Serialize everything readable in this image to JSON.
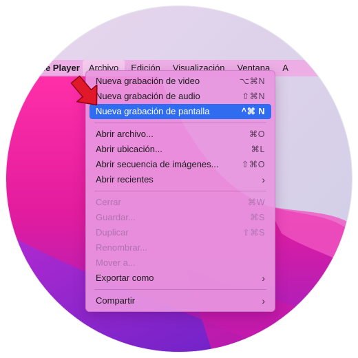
{
  "menubar": {
    "app_name": "ne Player",
    "items": [
      "Archivo",
      "Edición",
      "Visualización",
      "Ventana",
      "A"
    ]
  },
  "menu": {
    "items": [
      {
        "label": "Nueva grabación de video",
        "shortcut": "⌥⌘N",
        "state": "normal"
      },
      {
        "label": "Nueva grabación de audio",
        "shortcut": "⇧⌘N",
        "state": "normal"
      },
      {
        "label": "Nueva grabación de pantalla",
        "shortcut": "^⌘ N",
        "state": "highlighted"
      },
      {
        "label": "Abrir archivo...",
        "shortcut": "⌘O",
        "state": "normal"
      },
      {
        "label": "Abrir ubicación...",
        "shortcut": "⌘L",
        "state": "normal"
      },
      {
        "label": "Abrir secuencia de imágenes...",
        "shortcut": "⇧⌘O",
        "state": "normal"
      },
      {
        "label": "Abrir recientes",
        "shortcut": "",
        "state": "submenu"
      },
      {
        "label": "Cerrar",
        "shortcut": "⌘W",
        "state": "disabled"
      },
      {
        "label": "Guardar...",
        "shortcut": "⌘S",
        "state": "disabled"
      },
      {
        "label": "Duplicar",
        "shortcut": "⇧⌘S",
        "state": "disabled"
      },
      {
        "label": "Renombrar...",
        "shortcut": "",
        "state": "disabled"
      },
      {
        "label": "Mover a...",
        "shortcut": "",
        "state": "disabled"
      },
      {
        "label": "Exportar como",
        "shortcut": "",
        "state": "submenu"
      },
      {
        "label": "Compartir",
        "shortcut": "",
        "state": "submenu"
      }
    ],
    "submenu_chevron": "›"
  },
  "colors": {
    "highlight": "#2f6cf0",
    "menu_bg": "#e896e0",
    "arrow": "#e0182a"
  }
}
